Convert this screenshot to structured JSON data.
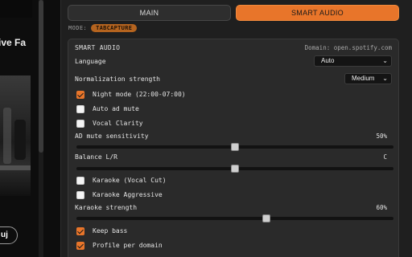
{
  "background": {
    "artist_text": "ive Fa",
    "pill_text": "uj"
  },
  "tabs": {
    "main_label": "MAIN",
    "smart_label": "SMART AUDIO"
  },
  "mode": {
    "label": "MODE:",
    "value": "TABCAPTURE"
  },
  "card": {
    "title": "SMART AUDIO",
    "domain": "Domain: open.spotify.com",
    "language": {
      "label": "Language",
      "value": "Auto"
    },
    "normalization": {
      "label": "Normalization strength",
      "value": "Medium"
    },
    "night_mode": {
      "label": "Night mode (22:00-07:00)",
      "checked": true
    },
    "auto_ad_mute": {
      "label": "Auto ad mute",
      "checked": false
    },
    "vocal_clarity": {
      "label": "Vocal Clarity",
      "checked": false
    },
    "ad_mute_sensitivity": {
      "label": "AD mute sensitivity",
      "value_text": "50%",
      "level": 0.5
    },
    "balance": {
      "label": "Balance L/R",
      "value_text": "C",
      "level": 0.5
    },
    "karaoke_vocal_cut": {
      "label": "Karaoke (Vocal Cut)",
      "checked": false
    },
    "karaoke_aggressive": {
      "label": "Karaoke Aggressive",
      "checked": false
    },
    "karaoke_strength": {
      "label": "Karaoke strength",
      "value_text": "60%",
      "level": 0.6
    },
    "keep_bass": {
      "label": "Keep bass",
      "checked": true
    },
    "profile_per_domain": {
      "label": "Profile per domain",
      "checked": true
    }
  },
  "colors": {
    "accent": "#e8752a",
    "panel_bg": "#1f1f1f",
    "card_bg": "#2a2a2a"
  },
  "icons": {
    "dropdown": "chevron-down-icon",
    "checkbox_checked": "checkmark-icon"
  }
}
